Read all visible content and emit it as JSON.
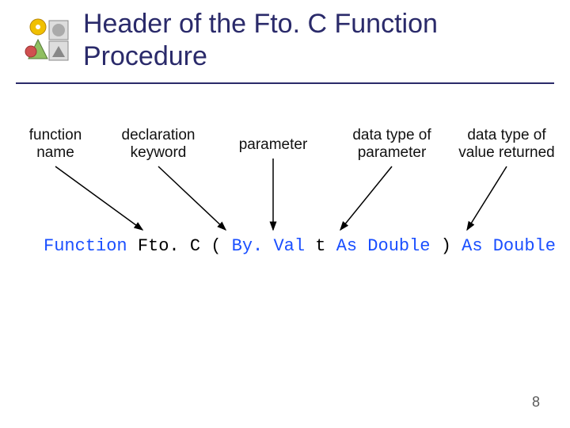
{
  "title": "Header of the Fto. C Function Procedure",
  "labels": {
    "funcname": "function\nname",
    "declkw": "declaration\nkeyword",
    "param": "parameter",
    "dtype_param": "data type of\nparameter",
    "dtype_ret": "data type of\nvalue returned"
  },
  "code": {
    "kw_function": "Function",
    "name": "Fto. C",
    "open_paren": "(",
    "byval": "By. Val",
    "t": "t",
    "as1": "As Double",
    "close_paren": ")",
    "as2": "As Double"
  },
  "pagenum": "8"
}
